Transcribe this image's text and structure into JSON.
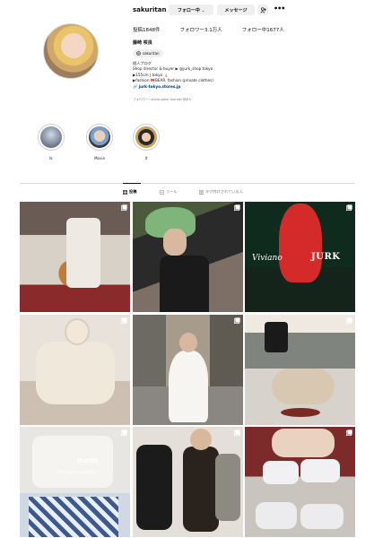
{
  "profile": {
    "username": "sakuritan",
    "follow_label": "フォロー中",
    "message_label": "メッセージ",
    "add_icon": "add-person-icon",
    "more_icon": "more-icon",
    "stats": {
      "posts": "投稿1848件",
      "followers": "フォロワー3.1万人",
      "following": "フォロー中1677人"
    },
    "fullname": "藤崎 咲良",
    "threads_handle": "sakuritan",
    "bio_lines": [
      "個人ブログ",
      "Shop director & buyer ▶ @jurk_shop.tokyo",
      "▶155cm | tokyo 🗼",
      "▶fashion 🎀BEAR. fashion (private clothes)",
      "🔗 jurk-tokyo.stores.jp"
    ],
    "followed_by": "フォロワー: shiroi.sakai   monaki   他8人"
  },
  "highlights": [
    {
      "label": "lk"
    },
    {
      "label": "Movie"
    },
    {
      "label": "lt"
    }
  ],
  "tabs": [
    {
      "label": "投稿",
      "icon": "grid-icon"
    },
    {
      "label": "リール",
      "icon": "reels-icon"
    },
    {
      "label": "タグ付けされている人",
      "icon": "tagged-icon"
    }
  ],
  "posts": [
    {
      "type": "carousel"
    },
    {
      "type": "carousel"
    },
    {
      "type": "carousel",
      "overlay_script": "Viviano",
      "overlay_brand": "JURK"
    },
    {
      "type": "carousel"
    },
    {
      "type": "carousel"
    },
    {
      "type": "carousel"
    },
    {
      "type": "carousel",
      "overlay_title": "Outfit",
      "overlay_sub": "I've worn recently"
    },
    {
      "type": "carousel"
    },
    {
      "type": "carousel"
    }
  ]
}
